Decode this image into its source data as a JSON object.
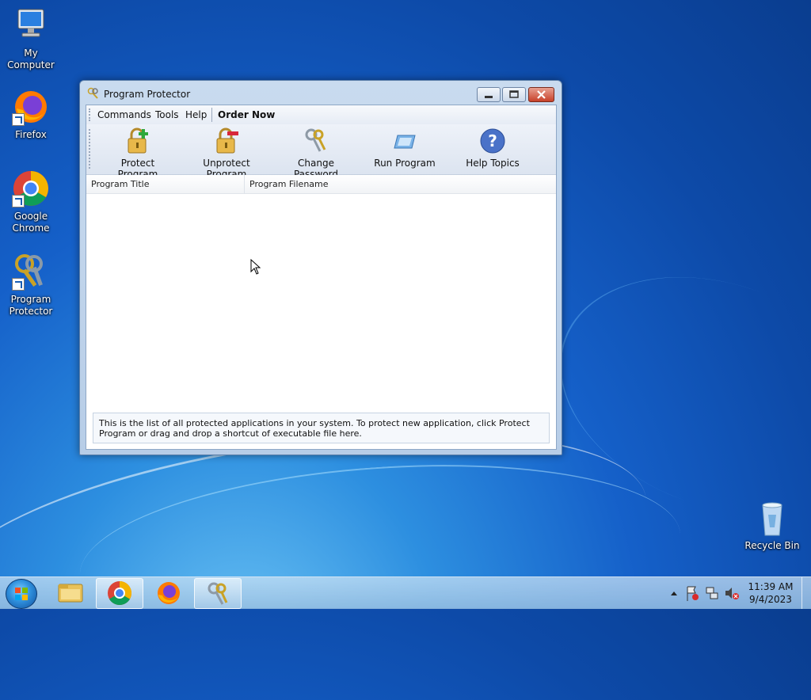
{
  "desktop": {
    "icons": [
      {
        "label": "My Computer"
      },
      {
        "label": "Firefox"
      },
      {
        "label": "Google Chrome"
      },
      {
        "label": "Program Protector"
      },
      {
        "label": "Recycle Bin"
      }
    ]
  },
  "window": {
    "title": "Program Protector",
    "menu": {
      "commands": "Commands",
      "tools": "Tools",
      "help": "Help",
      "order_now": "Order Now"
    },
    "toolbar": {
      "protect": "Protect Program",
      "unprotect": "Unprotect Program",
      "change_password": "Change Password",
      "run": "Run Program",
      "help_topics": "Help Topics"
    },
    "list": {
      "columns": [
        "Program Title",
        "Program Filename"
      ],
      "rows": []
    },
    "info": "This is the list of all protected applications in your system. To protect new application, click Protect Program or drag and drop a shortcut of executable file here."
  },
  "taskbar": {
    "clock_time": "11:39 AM",
    "clock_date": "9/4/2023"
  },
  "colors": {
    "desktop": "#1560c9",
    "close_button": "#c7412a",
    "window_frame": "#b7cde7"
  }
}
